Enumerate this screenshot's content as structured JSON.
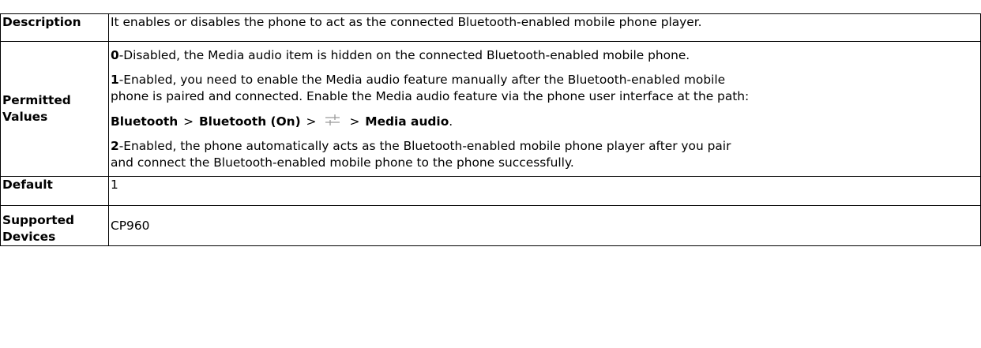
{
  "table": {
    "description": {
      "label": "Description",
      "text": "It enables or disables the phone to act as the connected Bluetooth-enabled mobile phone player."
    },
    "permitted_values": {
      "label_line1": "Permitted",
      "label_line2": "Values",
      "option0_value": "0",
      "option0_text": "-Disabled, the Media audio item is hidden on the connected Bluetooth-enabled mobile phone.",
      "option1_value": "1",
      "option1_text_line1": "-Enabled, you need to enable the Media audio feature manually after the Bluetooth-enabled mobile",
      "option1_text_line2": "phone is paired and connected. Enable the Media audio feature via the phone user interface at the path:",
      "path_step1": "Bluetooth",
      "path_sep1": ">",
      "path_step2": "Bluetooth (On)",
      "path_sep2": ">",
      "path_icon": "settings-sliders-icon",
      "path_sep3": ">",
      "path_step4": "Media audio",
      "path_end": ".",
      "option2_value": "2",
      "option2_text_line1": "-Enabled, the phone automatically acts as the Bluetooth-enabled mobile phone player after you pair",
      "option2_text_line2": "and connect the Bluetooth-enabled mobile phone to the phone successfully."
    },
    "default": {
      "label": "Default",
      "value": "1"
    },
    "supported_devices": {
      "label_line1": "Supported",
      "label_line2": "Devices",
      "value": "CP960"
    }
  },
  "colors": {
    "border": "#000000",
    "text": "#000000",
    "icon": "#9a9a9a"
  }
}
